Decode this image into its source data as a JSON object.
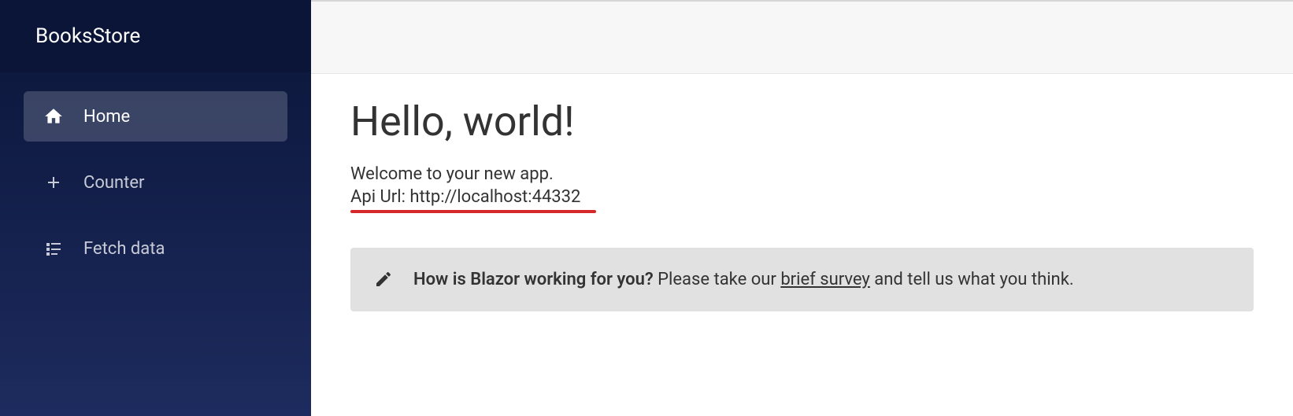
{
  "sidebar": {
    "title": "BooksStore",
    "items": [
      {
        "label": "Home",
        "icon": "home-icon",
        "active": true
      },
      {
        "label": "Counter",
        "icon": "plus-icon",
        "active": false
      },
      {
        "label": "Fetch data",
        "icon": "list-icon",
        "active": false
      }
    ]
  },
  "main": {
    "heading": "Hello, world!",
    "welcome": "Welcome to your new app.",
    "api_url": "Api Url: http://localhost:44332",
    "survey": {
      "question": "How is Blazor working for you?",
      "prompt_before": " Please take our ",
      "link": "brief survey",
      "prompt_after": " and tell us what you think."
    }
  }
}
